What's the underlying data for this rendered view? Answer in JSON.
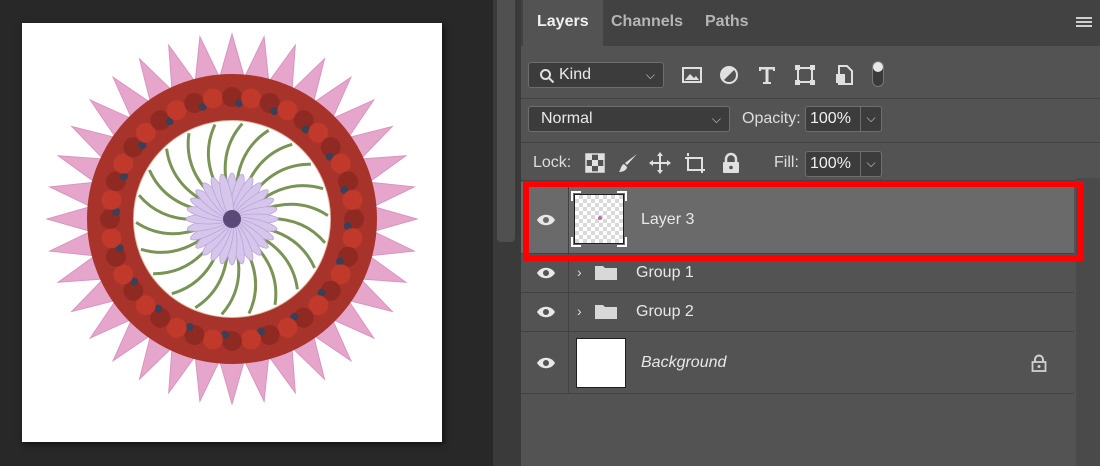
{
  "panel": {
    "tabs": [
      "Layers",
      "Channels",
      "Paths"
    ],
    "active_tab": "Layers"
  },
  "filter": {
    "kind_label": "Kind",
    "icons": [
      "image-filter-icon",
      "adjustment-filter-icon",
      "type-filter-icon",
      "shape-filter-icon",
      "smart-object-filter-icon",
      "filter-toggle"
    ]
  },
  "blend": {
    "mode": "Normal",
    "opacity_label": "Opacity:",
    "opacity": "100%"
  },
  "lock": {
    "label": "Lock:",
    "icons": [
      "lock-transparent-pixels-icon",
      "lock-image-pixels-icon",
      "lock-position-icon",
      "lock-artboard-icon",
      "lock-all-icon"
    ],
    "fill_label": "Fill:",
    "fill": "100%"
  },
  "layers": [
    {
      "name": "Layer 3",
      "type": "pixel",
      "selected": true,
      "visible": true
    },
    {
      "name": "Group 1",
      "type": "group",
      "selected": false,
      "visible": true
    },
    {
      "name": "Group 2",
      "type": "group",
      "selected": false,
      "visible": true
    },
    {
      "name": "Background",
      "type": "background",
      "selected": false,
      "visible": true,
      "locked": true
    }
  ],
  "colors": {
    "highlight": "#ff0000",
    "panel_bg": "#535353",
    "selected_row": "#6a6a6a",
    "canvas_bg": "#282828"
  }
}
